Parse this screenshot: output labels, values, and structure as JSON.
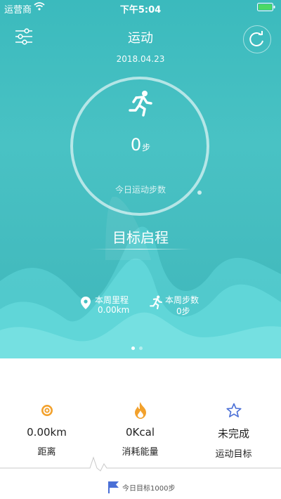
{
  "status_bar": {
    "carrier": "运营商",
    "time": "下午5:04"
  },
  "header": {
    "title": "运动",
    "date": "2018.04.23"
  },
  "ring": {
    "steps_value": "0",
    "steps_unit": "步",
    "caption": "今日运动步数"
  },
  "goal": {
    "title": "目标启程"
  },
  "weekly": {
    "distance_label": "本周里程",
    "distance_value": "0.00km",
    "steps_label": "本周步数",
    "steps_value": "0步"
  },
  "pager": {
    "pages": 2,
    "active": 0
  },
  "stats": {
    "distance": {
      "value": "0.00km",
      "label": "距离"
    },
    "energy": {
      "value": "0Kcal",
      "label": "消耗能量"
    },
    "target": {
      "value": "未完成",
      "label": "运动目标"
    }
  },
  "footer": {
    "goal_text": "今日目标1000步"
  },
  "colors": {
    "teal": "#3bbabd",
    "wave_light": "#6fdde0",
    "orange": "#f2a12c",
    "blue": "#4a6fd6"
  },
  "icons": [
    "menu-icon",
    "refresh-icon",
    "runner-icon",
    "location-icon",
    "flag-icon",
    "fire-icon",
    "star-icon",
    "signal-icon",
    "wifi-icon",
    "battery-icon"
  ]
}
